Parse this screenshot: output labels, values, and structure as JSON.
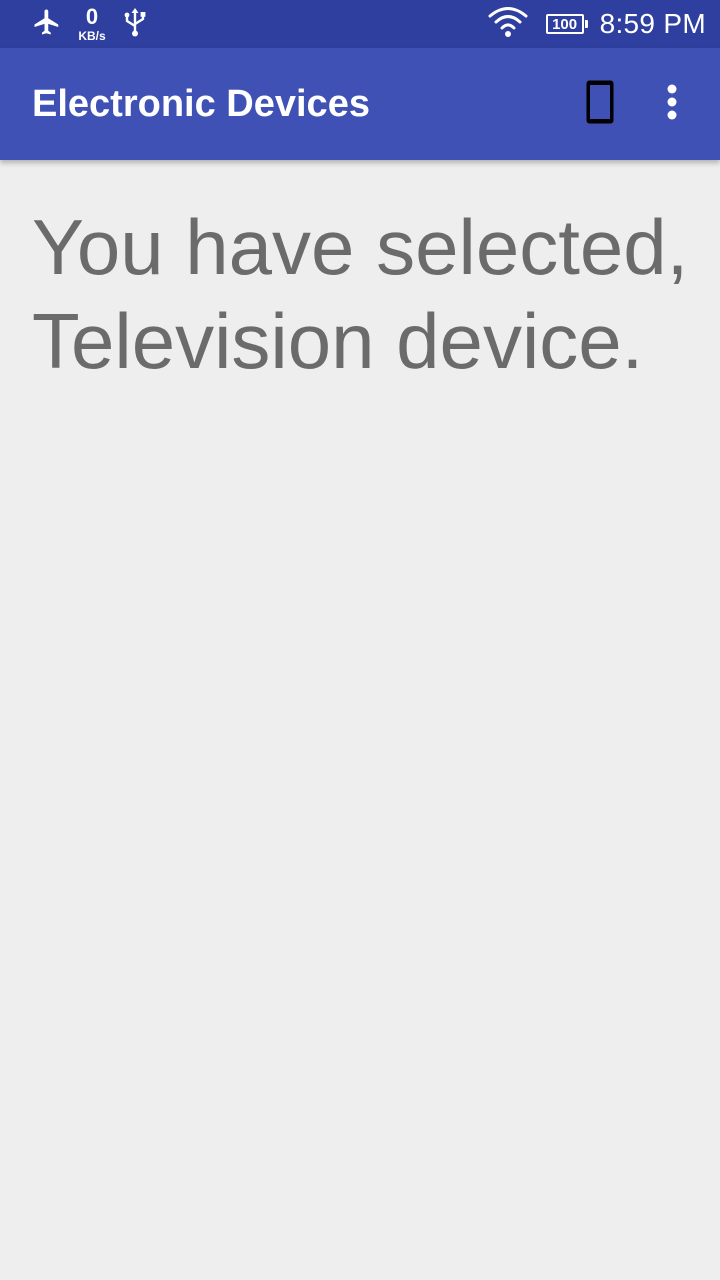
{
  "status_bar": {
    "icons": [
      "airplane-mode-icon",
      "usb-icon",
      "wifi-icon",
      "battery-icon"
    ],
    "net_speed_value": "0",
    "net_speed_unit": "KB/s",
    "battery_level": "100",
    "time": "8:59 PM",
    "background_color": "#2f3f9f"
  },
  "app_bar": {
    "title": "Electronic Devices",
    "actions": [
      "phone-icon",
      "overflow-menu-icon"
    ],
    "background_color": "#3f51b5"
  },
  "main": {
    "message": "You have selected, Television device.",
    "text_color": "#6b6b6b",
    "background_color": "#eeeeee"
  }
}
